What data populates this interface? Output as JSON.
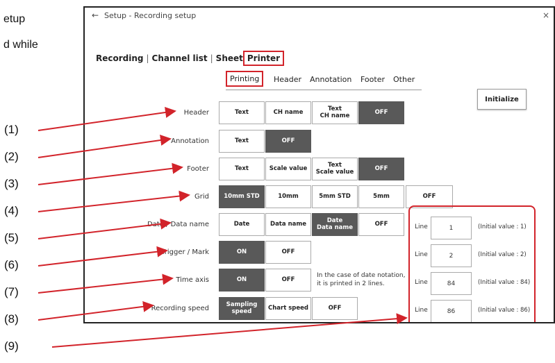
{
  "background_text": [
    "etup",
    "d while"
  ],
  "window": {
    "back_icon": "left-arrow-icon",
    "title": "Setup - Recording setup",
    "close": "×"
  },
  "main_tabs": [
    "Recording",
    "Channel list",
    "Sheet",
    "Printer"
  ],
  "main_tab_sep": "|",
  "active_main_tab": "Printer",
  "sub_tabs": [
    "Printing",
    "Header",
    "Annotation",
    "Footer",
    "Other"
  ],
  "active_sub_tab": "Printing",
  "initialize_label": "Initialize",
  "rows": [
    {
      "label": "Header",
      "buttons": [
        "Text",
        "CH name",
        "Text\nCH name",
        "OFF"
      ],
      "selected": 3
    },
    {
      "label": "Annotation",
      "buttons": [
        "Text",
        "OFF"
      ],
      "selected": 1
    },
    {
      "label": "Footer",
      "buttons": [
        "Text",
        "Scale value",
        "Text\nScale value",
        "OFF"
      ],
      "selected": 3
    },
    {
      "label": "Grid",
      "buttons": [
        "10mm STD",
        "10mm",
        "5mm STD",
        "5mm",
        "OFF"
      ],
      "selected": 0
    },
    {
      "label": "Date / Data name",
      "buttons": [
        "Date",
        "Data name",
        "Date\nData name",
        "OFF"
      ],
      "selected": 2
    },
    {
      "label": "Trigger / Mark",
      "buttons": [
        "ON",
        "OFF"
      ],
      "selected": 0
    },
    {
      "label": "Time axis",
      "buttons": [
        "ON",
        "OFF"
      ],
      "selected": 0
    },
    {
      "label": "Recording speed",
      "buttons": [
        "Sampling\nspeed",
        "Chart speed",
        "OFF"
      ],
      "selected": 0
    }
  ],
  "time_axis_note": "In the case of date notation,\nit is printed in 2 lines.",
  "line_settings": [
    {
      "label": "Line",
      "value": "1",
      "initial": "(Initial value : 1)"
    },
    {
      "label": "Line",
      "value": "2",
      "initial": "(Initial value : 2)"
    },
    {
      "label": "Line",
      "value": "84",
      "initial": "(Initial value : 84)"
    },
    {
      "label": "Line",
      "value": "86",
      "initial": "(Initial value : 86)"
    }
  ],
  "callouts": [
    "(1)",
    "(2)",
    "(3)",
    "(4)",
    "(5)",
    "(6)",
    "(7)",
    "(8)",
    "(9)"
  ],
  "colors": {
    "highlight": "#d2232a",
    "selected_button": "#595959"
  }
}
